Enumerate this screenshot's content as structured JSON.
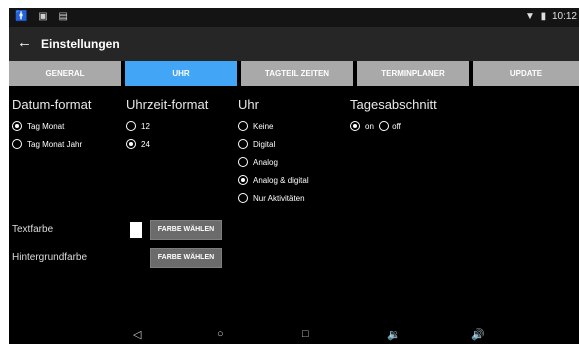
{
  "status_bar": {
    "left_icons": [
      "person-icon",
      "lock-icon",
      "image-icon"
    ],
    "right_icons": [
      "wifi-icon",
      "battery-icon"
    ],
    "time": "10:12"
  },
  "app_bar": {
    "title": "Einstellungen"
  },
  "tabs": [
    {
      "label": "GENERAL",
      "active": false
    },
    {
      "label": "UHR",
      "active": true
    },
    {
      "label": "TAGTEIL ZEITEN",
      "active": false
    },
    {
      "label": "TERMINPLANER",
      "active": false
    },
    {
      "label": "UPDATE",
      "active": false
    }
  ],
  "datum_format": {
    "title": "Datum-format",
    "options": [
      {
        "label": "Tag Monat",
        "checked": true
      },
      {
        "label": "Tag Monat Jahr",
        "checked": false
      }
    ]
  },
  "uhrzeit_format": {
    "title": "Uhrzeit-format",
    "options": [
      {
        "label": "12",
        "checked": false
      },
      {
        "label": "24",
        "checked": true
      }
    ]
  },
  "uhr": {
    "title": "Uhr",
    "options": [
      {
        "label": "Keine",
        "checked": false
      },
      {
        "label": "Digital",
        "checked": false
      },
      {
        "label": "Analog",
        "checked": false
      },
      {
        "label": "Analog & digital",
        "checked": true
      },
      {
        "label": "Nur Aktivitäten",
        "checked": false
      }
    ]
  },
  "tagesabschnitt": {
    "title": "Tagesabschnitt",
    "options": [
      {
        "label": "on",
        "checked": true
      },
      {
        "label": "off",
        "checked": false
      }
    ]
  },
  "textfarbe": {
    "label": "Textfarbe",
    "color": "#ffffff",
    "button": "FARBE WÄHLEN"
  },
  "hintergrundfarbe": {
    "label": "Hintergrundfarbe",
    "button": "FARBE WÄHLEN"
  },
  "colors": {
    "active_tab": "#42a5f5",
    "inactive_tab": "#a9a9a9",
    "app_bar": "#262626",
    "background": "#000000"
  },
  "nav_bar": {
    "icons": [
      "back-triangle-icon",
      "home-circle-icon",
      "recents-square-icon",
      "volume-down-icon",
      "volume-up-icon"
    ]
  }
}
